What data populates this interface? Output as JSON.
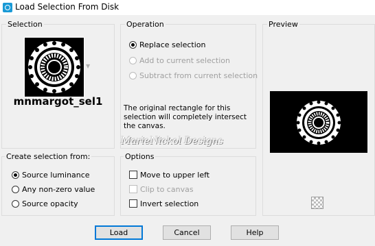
{
  "window": {
    "title": "Load Selection From Disk"
  },
  "selection": {
    "group_label": "Selection",
    "file_name": "mnmargot_sel1"
  },
  "operation": {
    "group_label": "Operation",
    "options": [
      {
        "label": "Replace selection",
        "checked": true,
        "enabled": true
      },
      {
        "label": "Add to current selection",
        "checked": false,
        "enabled": false
      },
      {
        "label": "Subtract from current selection",
        "checked": false,
        "enabled": false
      }
    ],
    "info_text": "The original rectangle for this selection will completely intersect the canvas."
  },
  "preview": {
    "group_label": "Preview"
  },
  "watermark": "MarieNickol Designs",
  "create_from": {
    "group_label": "Create selection from:",
    "options": [
      {
        "label": "Source luminance",
        "checked": true
      },
      {
        "label": "Any non-zero value",
        "checked": false
      },
      {
        "label": "Source opacity",
        "checked": false
      }
    ]
  },
  "options": {
    "group_label": "Options",
    "items": [
      {
        "label": "Move to upper left",
        "checked": false,
        "enabled": true
      },
      {
        "label": "Clip to canvas",
        "checked": false,
        "enabled": false
      },
      {
        "label": "Invert selection",
        "checked": false,
        "enabled": true
      }
    ]
  },
  "buttons": {
    "load": "Load",
    "cancel": "Cancel",
    "help": "Help"
  },
  "icons": {
    "app": "paintshop-app-icon",
    "dropdown": "chevron-down-icon",
    "checkerboard": "transparency-checkerboard-icon"
  },
  "colors": {
    "accent": "#0078d7",
    "preview_bg": "#000000"
  }
}
